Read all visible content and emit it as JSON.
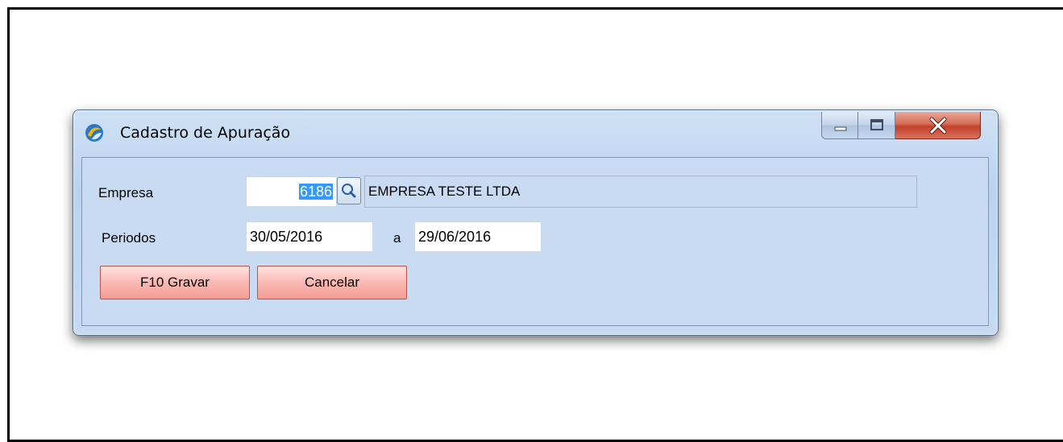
{
  "window": {
    "title": "Cadastro de Apuração"
  },
  "form": {
    "empresa_label": "Empresa",
    "empresa_code": "6186",
    "empresa_name": "EMPRESA TESTE LTDA",
    "periodos_label": "Periodos",
    "date_from": "30/05/2016",
    "separator": "a",
    "date_to": "29/06/2016"
  },
  "buttons": {
    "save_label": "F10 Gravar",
    "cancel_label": "Cancelar"
  },
  "icons": {
    "app": "app-logo-icon",
    "lookup": "magnifier-icon",
    "minimize": "minimize-icon",
    "maximize": "maximize-icon",
    "close": "close-icon"
  },
  "colors": {
    "window_bg": "#c9dbf3",
    "button_bg": "#fbb9b4",
    "selection": "#3399ff",
    "close_button": "#c2402a"
  }
}
